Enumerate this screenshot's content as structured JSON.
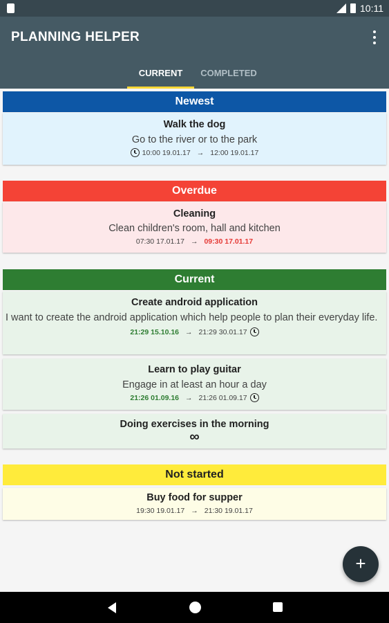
{
  "status_bar": {
    "time": "10:11"
  },
  "app_bar": {
    "title": "PLANNING HELPER",
    "menu_icon": "more-vert-icon"
  },
  "tabs": [
    {
      "label": "CURRENT",
      "selected": true
    },
    {
      "label": "COMPLETED",
      "selected": false
    }
  ],
  "colors": {
    "accent": "#fdd835",
    "appbar": "#455a64",
    "statusbar": "#37474f"
  },
  "sections": {
    "newest": {
      "header": "Newest",
      "color": "#0d57a6",
      "cards": [
        {
          "title": "Walk the dog",
          "description": "Go to the river or to the park",
          "start": "10:00 19.01.17",
          "arrow": "→",
          "end": "12:00 19.01.17",
          "alarm": true
        }
      ]
    },
    "overdue": {
      "header": "Overdue",
      "color": "#f44336",
      "cards": [
        {
          "title": "Cleaning",
          "description": "Clean children's room, hall and kitchen",
          "start": "07:30 17.01.17",
          "arrow": "→",
          "end": "09:30 17.01.17"
        }
      ]
    },
    "current": {
      "header": "Current",
      "color": "#2e7d32",
      "cards": [
        {
          "title": "Create android application",
          "description": "I want to create the android application which help people to plan their everyday life.",
          "start": "21:29 15.10.16",
          "arrow": "→",
          "end": "21:29 30.01.17",
          "alarm": true
        },
        {
          "title": "Learn to play guitar",
          "description": "Engage in at least an hour a day",
          "start": "21:26 01.09.16",
          "arrow": "→",
          "end": "21:26 01.09.17",
          "alarm": true
        },
        {
          "title": "Doing exercises in the morning",
          "description": "∞"
        }
      ]
    },
    "not_started": {
      "header": "Not started",
      "color": "#ffeb3b",
      "cards": [
        {
          "title": "Buy food for supper",
          "start": "19:30 19.01.17",
          "arrow": "→",
          "end": "21:30 19.01.17"
        }
      ]
    }
  },
  "fab": {
    "label": "+",
    "icon": "add-icon"
  }
}
